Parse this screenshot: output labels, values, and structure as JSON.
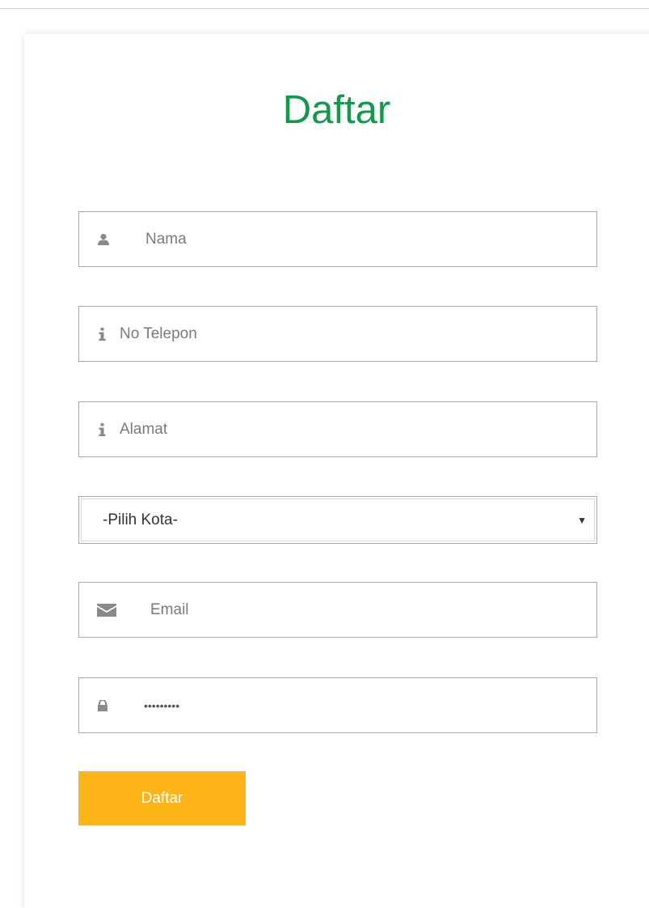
{
  "form": {
    "title": "Daftar",
    "fields": {
      "nama": {
        "placeholder": "Nama",
        "icon": "user-icon"
      },
      "telepon": {
        "placeholder": "No Telepon",
        "icon": "info-icon"
      },
      "alamat": {
        "placeholder": "Alamat",
        "icon": "info-icon"
      },
      "kota": {
        "selected": "-Pilih Kota-",
        "icon": "chevron-down-icon"
      },
      "email": {
        "placeholder": "Email",
        "icon": "envelope-icon"
      },
      "password": {
        "masked_value": "•••••••••",
        "icon": "lock-icon"
      }
    },
    "submit_label": "Daftar"
  },
  "colors": {
    "title": "#12994a",
    "button": "#fcb416",
    "icon": "#8a8a8a",
    "border": "#a9a9a9"
  }
}
